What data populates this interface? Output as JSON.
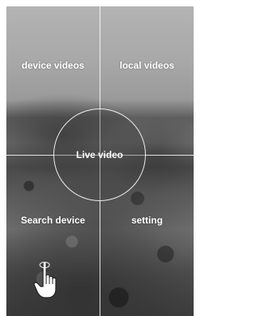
{
  "menu": {
    "top_left_label": "device videos",
    "top_right_label": "local videos",
    "center_label": "Live video",
    "bottom_left_label": "Search device",
    "bottom_right_label": "setting"
  },
  "icons": {
    "pointer": "hand-pointer-icon"
  },
  "colors": {
    "text": "#ffffff",
    "divider": "#ffffff"
  }
}
